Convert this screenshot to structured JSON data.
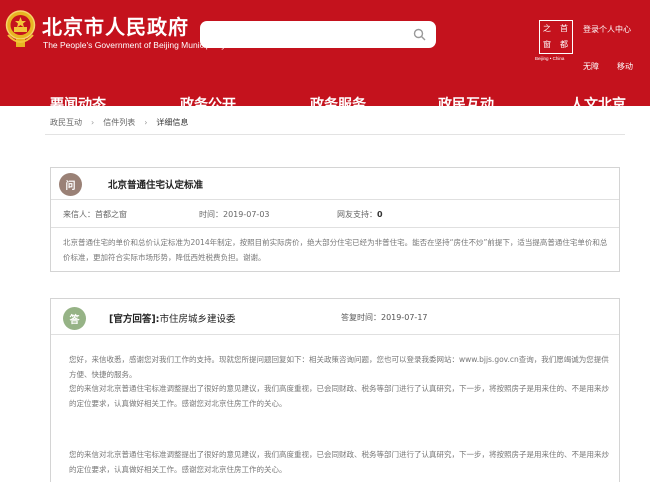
{
  "header": {
    "site_title": "北京市人民政府",
    "site_subtitle": "The People's Government of Beijing Municipality",
    "search": {
      "value": "",
      "placeholder": ""
    },
    "logo_badge": {
      "chars": [
        "之",
        "首",
        "窗",
        "都"
      ],
      "caption": "Beijing • China"
    },
    "user_center": "登录个人中心",
    "accessibility": "无障",
    "mobile": "移动",
    "colors": {
      "primary": "#c4121d"
    }
  },
  "nav": [
    "要闻动态",
    "政务公开",
    "政务服务",
    "政民互动",
    "人文北京"
  ],
  "breadcrumb": [
    "政民互动",
    "信件列表",
    "详细信息"
  ],
  "question": {
    "badge": "问",
    "title": "北京普通住宅认定标准",
    "sender_label": "来信人：",
    "sender": "首都之窗",
    "time_label": "时间：",
    "time": "2019-07-03",
    "support_label": "网友支持：",
    "support": "0",
    "body": "北京普通住宅的单价和总价认定标准为2014年制定，按照目前实际房价，绝大部分住宅已经为非普住宅。能否在坚持“房住不炒”前提下，适当提高普通住宅单价和总价标准，更加符合实际市场形势，降低西姓税费负担。谢谢。"
  },
  "answer": {
    "badge": "答",
    "tag": "[官方回答]:",
    "org": "市住房城乡建设委",
    "date_label": "答复时间：",
    "date": "2019-07-17",
    "paragraphs": [
      "您好，来信收悉，感谢您对我们工作的支持。现就您所提问题回复如下：相关政策咨询问题，您也可以登录我委网站：www.bjjs.gov.cn查询，我们愿竭诚为您提供方便、快捷的服务。",
      "您的来信对北京普通住宅标准调整提出了很好的意见建议，我们高度重视，已会同财政、税务等部门进行了认真研究，下一步，将按照房子是用来住的、不是用来炒的定位要求，认真做好相关工作。感谢您对北京住房工作的关心。",
      "您的来信对北京普通住宅标准调整提出了很好的意见建议，我们高度重视，已会同财政、税务等部门进行了认真研究，下一步，将按照房子是用来住的、不是用来炒的定位要求，认真做好相关工作。感谢您对北京住房工作的关心。"
    ],
    "colors": {
      "answer_badge": "#96b386",
      "question_badge": "#9a8176"
    }
  }
}
